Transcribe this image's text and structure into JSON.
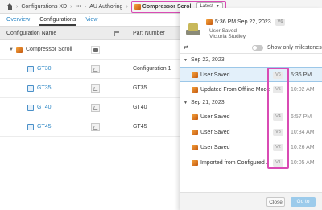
{
  "breadcrumb": {
    "items": [
      "Configurations XD",
      "•••",
      "AU Authoring"
    ],
    "active": "Compressor Scroll",
    "version_select": "Latest"
  },
  "tabs": [
    "Overview",
    "Configurations",
    "View"
  ],
  "table": {
    "headers": {
      "name": "Configuration Name",
      "part_number": "Part Number"
    },
    "root": {
      "name": "Compressor Scroll",
      "part_number": ""
    },
    "rows": [
      {
        "name": "GT30",
        "part_number": "Configuration 1"
      },
      {
        "name": "GT35",
        "part_number": "GT35"
      },
      {
        "name": "GT40",
        "part_number": "GT40"
      },
      {
        "name": "GT45",
        "part_number": "GT45"
      }
    ]
  },
  "panel": {
    "title": "5:36 PM Sep 22, 2023",
    "title_version": "V6",
    "subtitle_1": "User Saved",
    "subtitle_2": "Victoria Studley",
    "milestones_label": "Show only milestones",
    "groups": [
      {
        "date": "Sep 22, 2023",
        "versions": [
          {
            "label": "User Saved",
            "version": "V6",
            "time": "5:36 PM"
          },
          {
            "label": "Updated From Offline Mode",
            "version": "V5",
            "time": "10:02 AM"
          }
        ]
      },
      {
        "date": "Sep 21, 2023",
        "versions": [
          {
            "label": "User Saved",
            "version": "V4",
            "time": "6:57 PM"
          },
          {
            "label": "User Saved",
            "version": "V3",
            "time": "10:34 AM"
          },
          {
            "label": "User Saved",
            "version": "V2",
            "time": "10:26 AM"
          },
          {
            "label": "Imported from Configured ...",
            "version": "V1",
            "time": "10:05 AM"
          }
        ]
      }
    ],
    "close_label": "Close",
    "goto_label": "Go to"
  },
  "colors": {
    "highlight": "#d94bb4",
    "link": "#2b86c5",
    "selected_row": "#e3f0fa"
  }
}
